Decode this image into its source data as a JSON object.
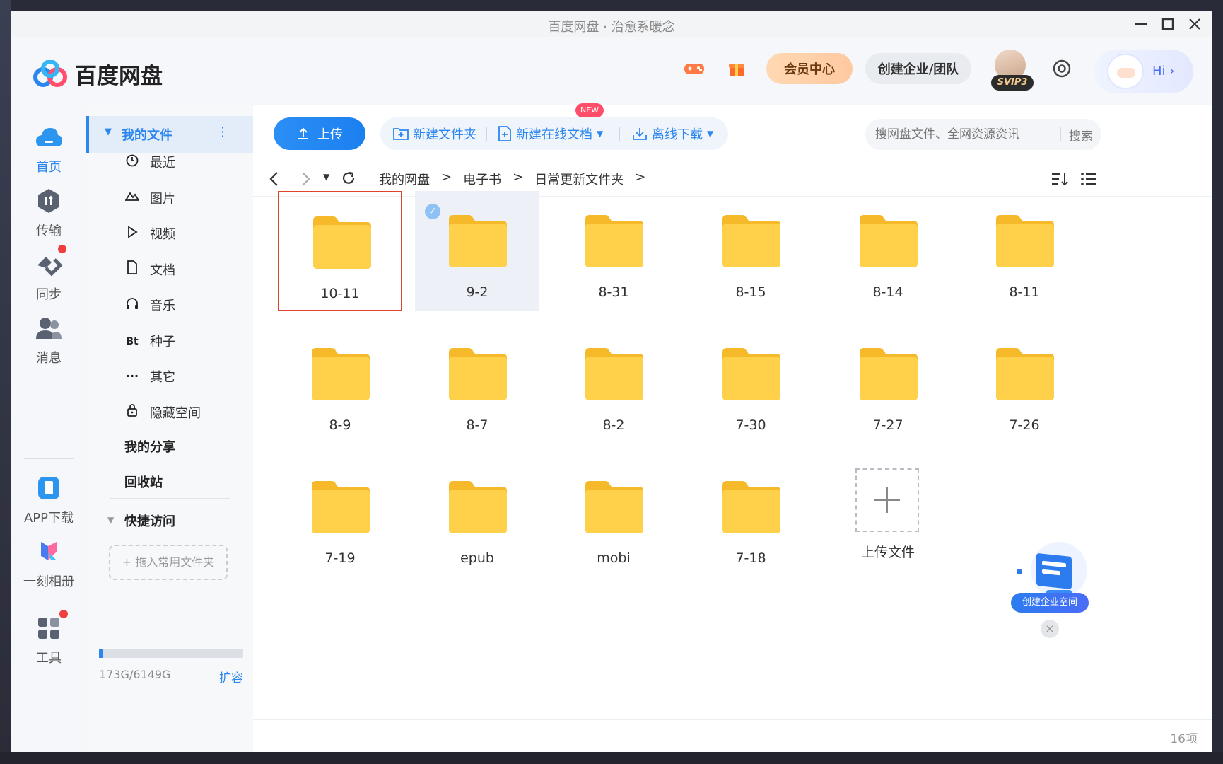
{
  "window": {
    "title": "百度网盘 · 治愈系暖念"
  },
  "header": {
    "app_name": "百度网盘",
    "vip_center": "会员中心",
    "create_team": "创建企业/团队",
    "vip_badge": "SVIP3",
    "hi": "Hi ›"
  },
  "left_nav": {
    "home": "首页",
    "transfer": "传输",
    "sync": "同步",
    "messages": "消息",
    "app_download": "APP下载",
    "album": "一刻相册",
    "tools": "工具"
  },
  "sidebar": {
    "my_files": "我的文件",
    "items": [
      {
        "label": "最近",
        "icon": "clock-icon"
      },
      {
        "label": "图片",
        "icon": "mountain-icon"
      },
      {
        "label": "视频",
        "icon": "play-icon"
      },
      {
        "label": "文档",
        "icon": "document-icon"
      },
      {
        "label": "音乐",
        "icon": "headphones-icon"
      },
      {
        "label": "种子",
        "icon": "bt-icon"
      },
      {
        "label": "其它",
        "icon": "ellipsis-icon"
      },
      {
        "label": "隐藏空间",
        "icon": "lock-icon"
      }
    ],
    "my_share": "我的分享",
    "recycle_bin": "回收站",
    "quick_access": "快捷访问",
    "drop_hint": "+ 拖入常用文件夹",
    "storage": "173G/6149G",
    "storage_used_fraction": 0.028,
    "expand": "扩容"
  },
  "toolbar": {
    "upload": "上传",
    "new_folder": "新建文件夹",
    "new_online_doc": "新建在线文档",
    "new_badge": "NEW",
    "offline_download": "离线下载",
    "search_placeholder": "搜网盘文件、全网资源资讯",
    "search_button": "搜索"
  },
  "breadcrumb": [
    "我的网盘",
    "电子书",
    "日常更新文件夹"
  ],
  "files": [
    "10-11",
    "9-2",
    "8-31",
    "8-15",
    "8-14",
    "8-11",
    "8-9",
    "8-7",
    "8-2",
    "7-30",
    "7-27",
    "7-26",
    "7-19",
    "epub",
    "mobi",
    "7-18"
  ],
  "upload_tile": "上传文件",
  "promo": {
    "label": "创建企业空间"
  },
  "status": {
    "count": "16项"
  },
  "colors": {
    "accent": "#2c86f0",
    "folder": "#ffcc33",
    "highlight_border": "#e0442d"
  }
}
